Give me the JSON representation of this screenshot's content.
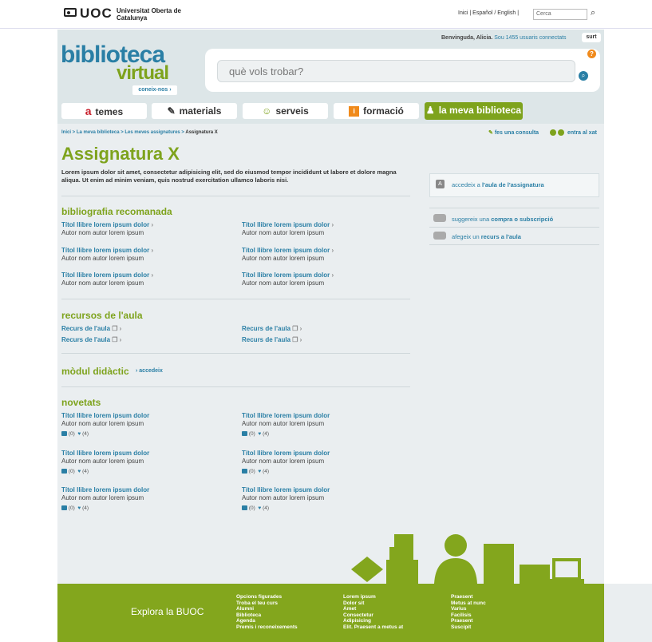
{
  "top": {
    "logo_text": "UOC",
    "logo_university": "Universitat Oberta de Catalunya",
    "links": "Inici | Español / English |",
    "search_placeholder": "Cerca"
  },
  "header": {
    "welcome": "Benvinguda, Alicia.",
    "connected": "Sou 1455 usuaris connectats",
    "logout": "surt",
    "brand_line1": "biblioteca",
    "brand_line2": "virtual",
    "about": "coneix-nos",
    "search_placeholder": "què vols trobar?"
  },
  "tabs": [
    {
      "label": "temes",
      "icon": "a"
    },
    {
      "label": "materials",
      "icon": "✎"
    },
    {
      "label": "serveis",
      "icon": "☺"
    },
    {
      "label": "formació",
      "icon": "i"
    },
    {
      "label": "la meva biblioteca",
      "icon": "♟"
    }
  ],
  "breadcrumb": {
    "inici": "Inici",
    "meva": "La meva biblioteca",
    "assignatures": "Les meves assignatures",
    "current": "Assignatura X"
  },
  "actions": {
    "consulta": "fes una consulta",
    "xat": "entra al xat"
  },
  "main": {
    "title": "Assignatura X",
    "intro": "Lorem ipsum dolor sit amet, consectetur adipisicing elit, sed do eiusmod tempor incididunt ut labore et dolore magna aliqua. Ut enim ad minim veniam, quis nostrud exercitation ullamco laboris nisi.",
    "biblio_title": "bibliografia recomanada",
    "book_title": "Títol llibre lorem ipsum dolor",
    "book_author": "Autor nom autor lorem ipsum",
    "recursos_title": "recursos de l'aula",
    "recurs_label": "Recurs de l'aula",
    "modul_title": "mòdul didàctic",
    "modul_link": "accedeix",
    "novetats_title": "novetats",
    "nov_comments": "(0)",
    "nov_likes": "(4)"
  },
  "sidebar": {
    "aula_prefix": "accedeix a",
    "aula_bold": "l'aula de l'assignatura",
    "compra_prefix": "suggereix una",
    "compra_bold": "compra o subscripció",
    "recurs_prefix": "afegeix un",
    "recurs_bold": "recurs a l'aula"
  },
  "footer": {
    "explora": "Explora la BUOC",
    "col1": [
      "Opcions figurades",
      "Troba el teu curs",
      "Alumni",
      "Biblioteca",
      "Agenda",
      "Premis i reconeixements"
    ],
    "col2": [
      "Lorem ipsum",
      "Dolor sit",
      "Amet",
      "Consectetur",
      "Adipisicing",
      "Elit. Praesent a metus at"
    ],
    "col3": [
      "Praesent",
      "Metus at nunc",
      "Varius",
      "Facilisis",
      "Praesent",
      "Suscipit"
    ]
  },
  "colors": {
    "green": "#7ea31d",
    "blue": "#2a7fa5",
    "orange": "#f08a1b",
    "red": "#c8202c"
  }
}
